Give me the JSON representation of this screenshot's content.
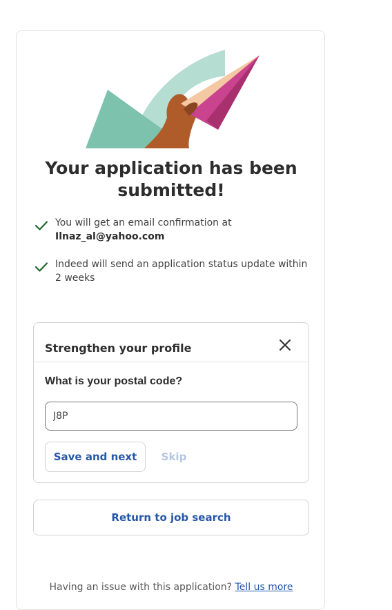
{
  "confirmation": {
    "headline": "Your application has been submitted!",
    "items": [
      {
        "text": "You will get an email confirmation at",
        "email": "Ilnaz_al@yahoo.com"
      },
      {
        "text": "Indeed will send an application status update within 2 weeks"
      }
    ]
  },
  "profile": {
    "title": "Strengthen your profile",
    "question": "What is your postal code?",
    "postal_value": "J8P",
    "save_label": "Save and next",
    "skip_label": "Skip"
  },
  "actions": {
    "return_label": "Return to job search"
  },
  "footer": {
    "text": "Having an issue with this application?",
    "link": "Tell us more"
  },
  "colors": {
    "link_blue": "#2557a7",
    "check_green": "#1f662c",
    "skip_disabled": "#b4c6e3",
    "illustration_teal": "#7dc2ad",
    "illustration_light_teal": "#b6ddd1",
    "paper_plane_pink": "#c9438f",
    "paper_plane_peach": "#f3c8a2",
    "hand_brown": "#b05c2a"
  },
  "icons": {
    "check": "checkmark-icon",
    "close": "close-icon"
  }
}
